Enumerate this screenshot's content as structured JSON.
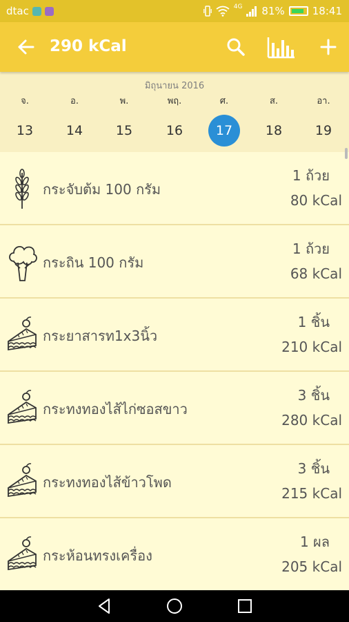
{
  "status_bar": {
    "carrier": "dtac",
    "network": "4G",
    "battery": "81%",
    "time": "18:41"
  },
  "app_bar": {
    "title": "290 kCal",
    "icons": [
      "back-arrow-icon",
      "search-icon",
      "bar-chart-icon",
      "plus-icon"
    ]
  },
  "calendar": {
    "month": "มิถุนายน 2016",
    "days": [
      {
        "dow": "จ.",
        "date": "13"
      },
      {
        "dow": "อ.",
        "date": "14"
      },
      {
        "dow": "พ.",
        "date": "15"
      },
      {
        "dow": "พฤ.",
        "date": "16"
      },
      {
        "dow": "ศ.",
        "date": "17"
      },
      {
        "dow": "ส.",
        "date": "18"
      },
      {
        "dow": "อา.",
        "date": "19"
      }
    ],
    "selected_date": "17",
    "selected_color": "#2a8fd6"
  },
  "foods": [
    {
      "name": "กระจับต้ม 100 กรัม",
      "quantity": "1 ถ้วย",
      "kcal": "80 kCal",
      "icon": "grain-icon"
    },
    {
      "name": "กระถิน 100 กรัม",
      "quantity": "1 ถ้วย",
      "kcal": "68 kCal",
      "icon": "broccoli-icon"
    },
    {
      "name": "กระยาสารท1x3นิ้ว",
      "quantity": "1 ชิ้น",
      "kcal": "210 kCal",
      "icon": "cake-icon"
    },
    {
      "name": "กระทงทองไส้ไก่ซอสขาว",
      "quantity": "3 ชิ้น",
      "kcal": "280 kCal",
      "icon": "cake-icon"
    },
    {
      "name": "กระทงทองไส้ข้าวโพด",
      "quantity": "3 ชิ้น",
      "kcal": "215 kCal",
      "icon": "cake-icon"
    },
    {
      "name": "กระห้อนทรงเครื่อง",
      "quantity": "1 ผล",
      "kcal": "205 kCal",
      "icon": "cake-icon"
    }
  ],
  "colors": {
    "app_bar": "#f4cd3b",
    "status_bar": "#e3c22a",
    "calendar_bg": "#f9f0c3",
    "row_bg": "#fffbd5"
  }
}
